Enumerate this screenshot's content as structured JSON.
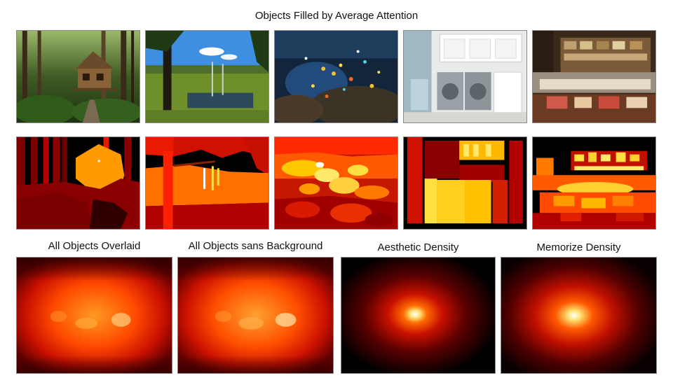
{
  "title": "Objects Filled by Average Attention",
  "bottom_labels": {
    "overlaid": "All Objects Overlaid",
    "sans_background": "All Objects sans Background",
    "aesthetic": "Aesthetic Density",
    "memorize": "Memorize Density"
  },
  "photos": [
    {
      "scene": "treehouse in forest"
    },
    {
      "scene": "marsh with trees and blue sky"
    },
    {
      "scene": "coral reef with tropical fish"
    },
    {
      "scene": "laundry room with washer and dryer"
    },
    {
      "scene": "grocery deli counter"
    }
  ],
  "colors": {
    "heat_black": "#000000",
    "heat_dark": "#7a0000",
    "heat_red": "#d01000",
    "heat_orange": "#ff7a00",
    "heat_yellow": "#ffe040",
    "heat_white": "#ffffff"
  }
}
